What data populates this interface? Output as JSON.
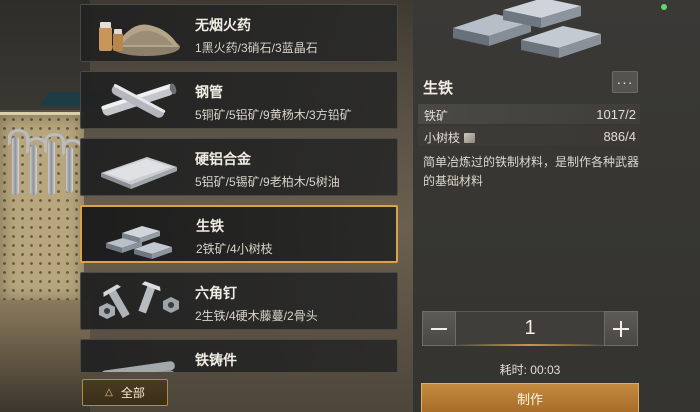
{
  "recipes": [
    {
      "name": "无烟火药",
      "req": "1黑火药/3硝石/3蓝晶石",
      "icon": "smokeless-powder-icon"
    },
    {
      "name": "钢管",
      "req": "5铜矿/5铝矿/9黄杨木/3方铅矿",
      "icon": "steel-pipe-icon"
    },
    {
      "name": "硬铝合金",
      "req": "5铝矿/5锡矿/9老柏木/5树油",
      "icon": "duralumin-plate-icon"
    },
    {
      "name": "生铁",
      "req": "2铁矿/4小树枝",
      "icon": "pig-iron-icon"
    },
    {
      "name": "六角钉",
      "req": "2生铁/4硬木藤蔓/2骨头",
      "icon": "hex-bolt-icon"
    },
    {
      "name": "铁铸件",
      "req": "",
      "icon": "iron-casting-icon"
    }
  ],
  "filter": {
    "label": "全部"
  },
  "detail": {
    "title": "生铁",
    "more_label": "···",
    "materials": [
      {
        "name": "铁矿",
        "count": "1017/2"
      },
      {
        "name": "小树枝",
        "count": "886/4"
      }
    ],
    "description": "简单冶炼过的铁制材料，是制作各种武器的基础材料",
    "quantity": "1",
    "time": "耗时: 00:03",
    "craft_label": "制作"
  },
  "colors": {
    "selected_border": "#d8a545",
    "craft_button": "#b97c33"
  }
}
